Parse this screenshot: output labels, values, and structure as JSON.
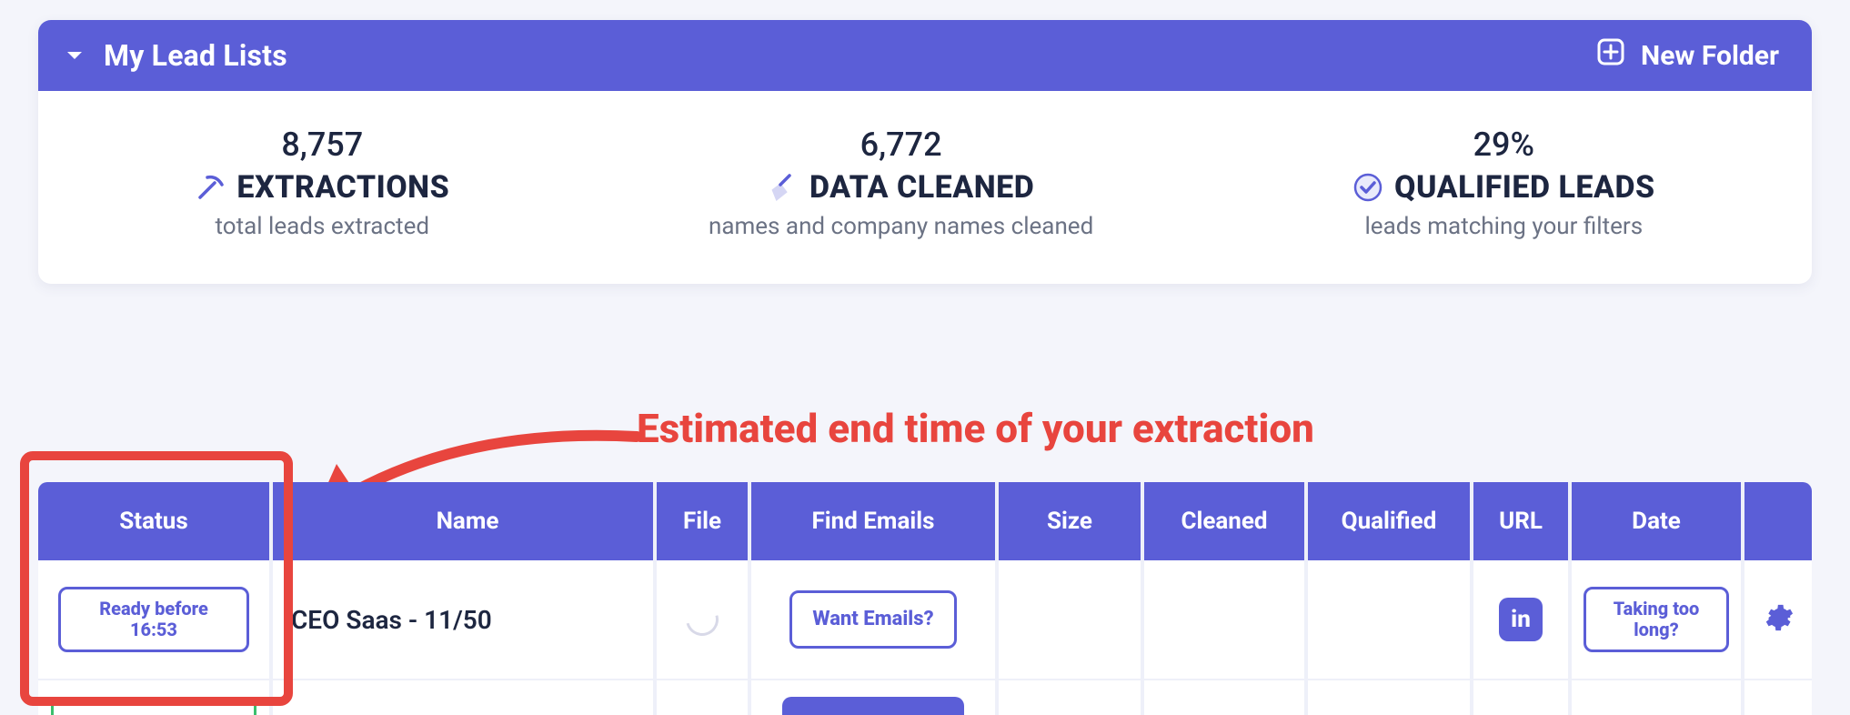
{
  "header": {
    "title": "My Lead Lists",
    "new_folder": "New Folder"
  },
  "stats": {
    "extractions": {
      "value": "8,757",
      "label": "EXTRACTIONS",
      "sub": "total leads extracted"
    },
    "cleaned": {
      "value": "6,772",
      "label": "DATA CLEANED",
      "sub": "names and company names cleaned"
    },
    "qualified": {
      "value": "29%",
      "label": "QUALIFIED LEADS",
      "sub": "leads matching your filters"
    }
  },
  "annotation": {
    "text": "Estimated end time of your extraction"
  },
  "table": {
    "headers": {
      "status": "Status",
      "name": "Name",
      "file": "File",
      "emails": "Find Emails",
      "size": "Size",
      "cleaned": "Cleaned",
      "qualified": "Qualified",
      "url": "URL",
      "date": "Date"
    },
    "rows": [
      {
        "status": "Ready before 16:53",
        "name": "CEO Saas - 11/50",
        "emails": "Want Emails?",
        "date": "Taking too long?",
        "url_icon": "in"
      }
    ]
  },
  "colors": {
    "accent": "#5b5ed7",
    "danger": "#e8453e",
    "success": "#3bbf6d",
    "text": "#1d2640",
    "muted": "#6b7284"
  }
}
